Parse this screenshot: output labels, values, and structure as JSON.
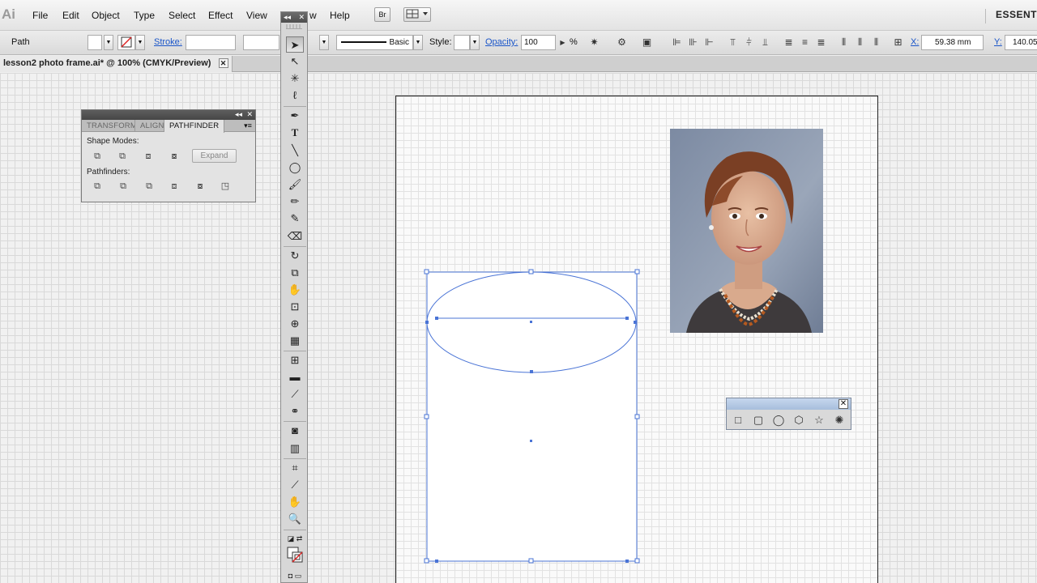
{
  "app": {
    "logo": "Ai",
    "workspace": "ESSENT"
  },
  "menus": [
    "File",
    "Edit",
    "Object",
    "Type",
    "Select",
    "Effect",
    "View",
    "w",
    "Help"
  ],
  "menubar_icons": {
    "bridge": "Br",
    "arrange": "arrange-documents-icon"
  },
  "control": {
    "object_type": "Path",
    "stroke_label": "Stroke:",
    "brush_label": "Basic",
    "style_label": "Style:",
    "opacity_label": "Opacity:",
    "opacity_value": "100",
    "percent": "%",
    "x_label": "X:",
    "x_value": "59.38 mm",
    "y_label": "Y:",
    "y_value": "140.05"
  },
  "document": {
    "tab_title": "lesson2 photo frame.ai* @ 100% (CMYK/Preview)",
    "close": "✕"
  },
  "pathfinder": {
    "tabs": [
      "TRANSFORM",
      "ALIGN",
      "PATHFINDER"
    ],
    "shape_modes_label": "Shape Modes:",
    "pathfinders_label": "Pathfinders:",
    "expand_label": "Expand"
  },
  "tools": {
    "panel_close": "✕",
    "panel_collapse": "◂◂"
  },
  "shapes_panel": {
    "close": "✕"
  },
  "colors": {
    "selection": "#4a74d6",
    "accent_link": "#1a55c9"
  }
}
